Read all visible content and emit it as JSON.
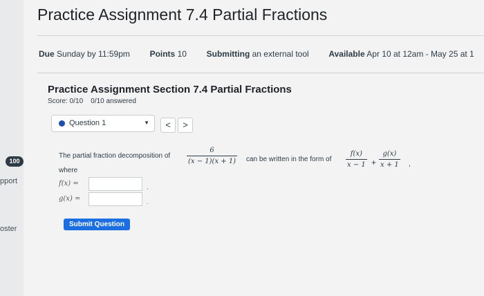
{
  "sidebar": {
    "badge": "100",
    "links": [
      "pport",
      "oster"
    ]
  },
  "header": {
    "title": "Practice Assignment 7.4 Partial Fractions"
  },
  "meta": {
    "due_label": "Due",
    "due_value": "Sunday by 11:59pm",
    "points_label": "Points",
    "points_value": "10",
    "submitting_label": "Submitting",
    "submitting_value": "an external tool",
    "available_label": "Available",
    "available_value": "Apr 10 at 12am - May 25 at 1"
  },
  "assignment": {
    "section_title": "Practice Assignment Section 7.4 Partial Fractions",
    "score": "Score: 0/10",
    "answered": "0/10 answered"
  },
  "question_nav": {
    "selected": "Question 1",
    "prev": "<",
    "next": ">"
  },
  "question": {
    "intro": "The partial fraction decomposition of",
    "fraction_num": "6",
    "fraction_den": "(x − 1)(x + 1)",
    "middle": "can be written in the form of",
    "term1_num": "f(x)",
    "term1_den": "x − 1",
    "plus": "+",
    "term2_num": "g(x)",
    "term2_den": "x + 1",
    "trail": ",",
    "where": "where",
    "f_label": "f(x) =",
    "g_label": "g(x) =",
    "f_value": "",
    "g_value": ""
  },
  "actions": {
    "submit": "Submit Question"
  }
}
